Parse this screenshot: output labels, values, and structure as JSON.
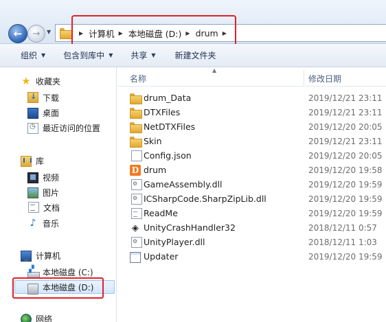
{
  "address_bar": {
    "crumbs": [
      "计算机",
      "本地磁盘 (D:)",
      "drum"
    ]
  },
  "toolbar": {
    "organize": "组织",
    "include_in_library": "包含到库中",
    "share": "共享",
    "new_folder": "新建文件夹"
  },
  "nav": {
    "favorites": "收藏夹",
    "downloads": "下载",
    "desktop": "桌面",
    "recent": "最近访问的位置",
    "libraries": "库",
    "videos": "视频",
    "pictures": "图片",
    "documents": "文档",
    "music": "音乐",
    "computer": "计算机",
    "drive_c": "本地磁盘 (C:)",
    "drive_d": "本地磁盘 (D:)",
    "network": "网络"
  },
  "columns": {
    "name": "名称",
    "date_modified": "修改日期"
  },
  "files": [
    {
      "name": "drum_Data",
      "date": "2019/12/21 23:11",
      "icon": "folder-icon"
    },
    {
      "name": "DTXFiles",
      "date": "2019/12/21 23:11",
      "icon": "folder-icon"
    },
    {
      "name": "NetDTXFiles",
      "date": "2019/12/20 20:05",
      "icon": "folder-icon"
    },
    {
      "name": "Skin",
      "date": "2019/12/21 23:11",
      "icon": "folder-icon"
    },
    {
      "name": "Config.json",
      "date": "2019/12/20 20:05",
      "icon": "file-icon"
    },
    {
      "name": "drum",
      "date": "2019/12/20 19:58",
      "icon": "drum-app-icon"
    },
    {
      "name": "GameAssembly.dll",
      "date": "2019/12/20 19:59",
      "icon": "dll-icon"
    },
    {
      "name": "ICSharpCode.SharpZipLib.dll",
      "date": "2019/12/20 19:59",
      "icon": "dll-icon"
    },
    {
      "name": "ReadMe",
      "date": "2019/12/20 19:59",
      "icon": "text-file-icon"
    },
    {
      "name": "UnityCrashHandler32",
      "date": "2018/12/11 0:57",
      "icon": "unity-icon"
    },
    {
      "name": "UnityPlayer.dll",
      "date": "2018/12/11 1:03",
      "icon": "dll-icon"
    },
    {
      "name": "Updater",
      "date": "2019/12/20 19:59",
      "icon": "exe-icon"
    }
  ],
  "colors": {
    "highlight_red": "#e0202a",
    "selection_blue": "#d4e6fb"
  }
}
